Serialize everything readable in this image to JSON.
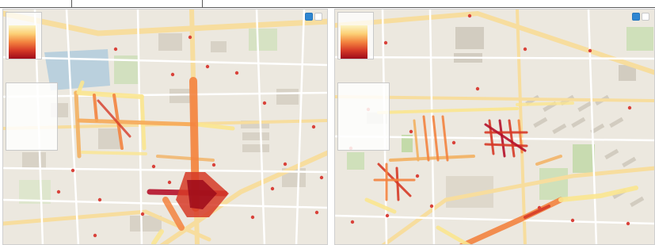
{
  "panels": [
    {
      "legend": {
        "title": ""
      },
      "buttons": {
        "primary": "",
        "secondary": ""
      },
      "layer_list": {
        "title": "",
        "items": [
          "",
          "",
          "",
          "",
          ""
        ]
      }
    },
    {
      "legend": {
        "title": ""
      },
      "buttons": {
        "primary": "",
        "secondary": ""
      },
      "layer_list": {
        "title": "",
        "items": [
          "",
          "",
          "",
          "",
          ""
        ]
      }
    }
  ],
  "colors": {
    "map_base": "#ece8df",
    "park": "#c8ddb0",
    "water": "#aac8dc",
    "road_major": "#f7dd9e",
    "road_minor": "#ffffff",
    "poi": "#d9423a",
    "heat_low": "#fbe58f",
    "heat_mid": "#f3833f",
    "heat_high": "#b5112a",
    "button_primary": "#2f86d1"
  },
  "icons": {
    "poi_marker": "map-pin-icon",
    "building": "building-block"
  }
}
